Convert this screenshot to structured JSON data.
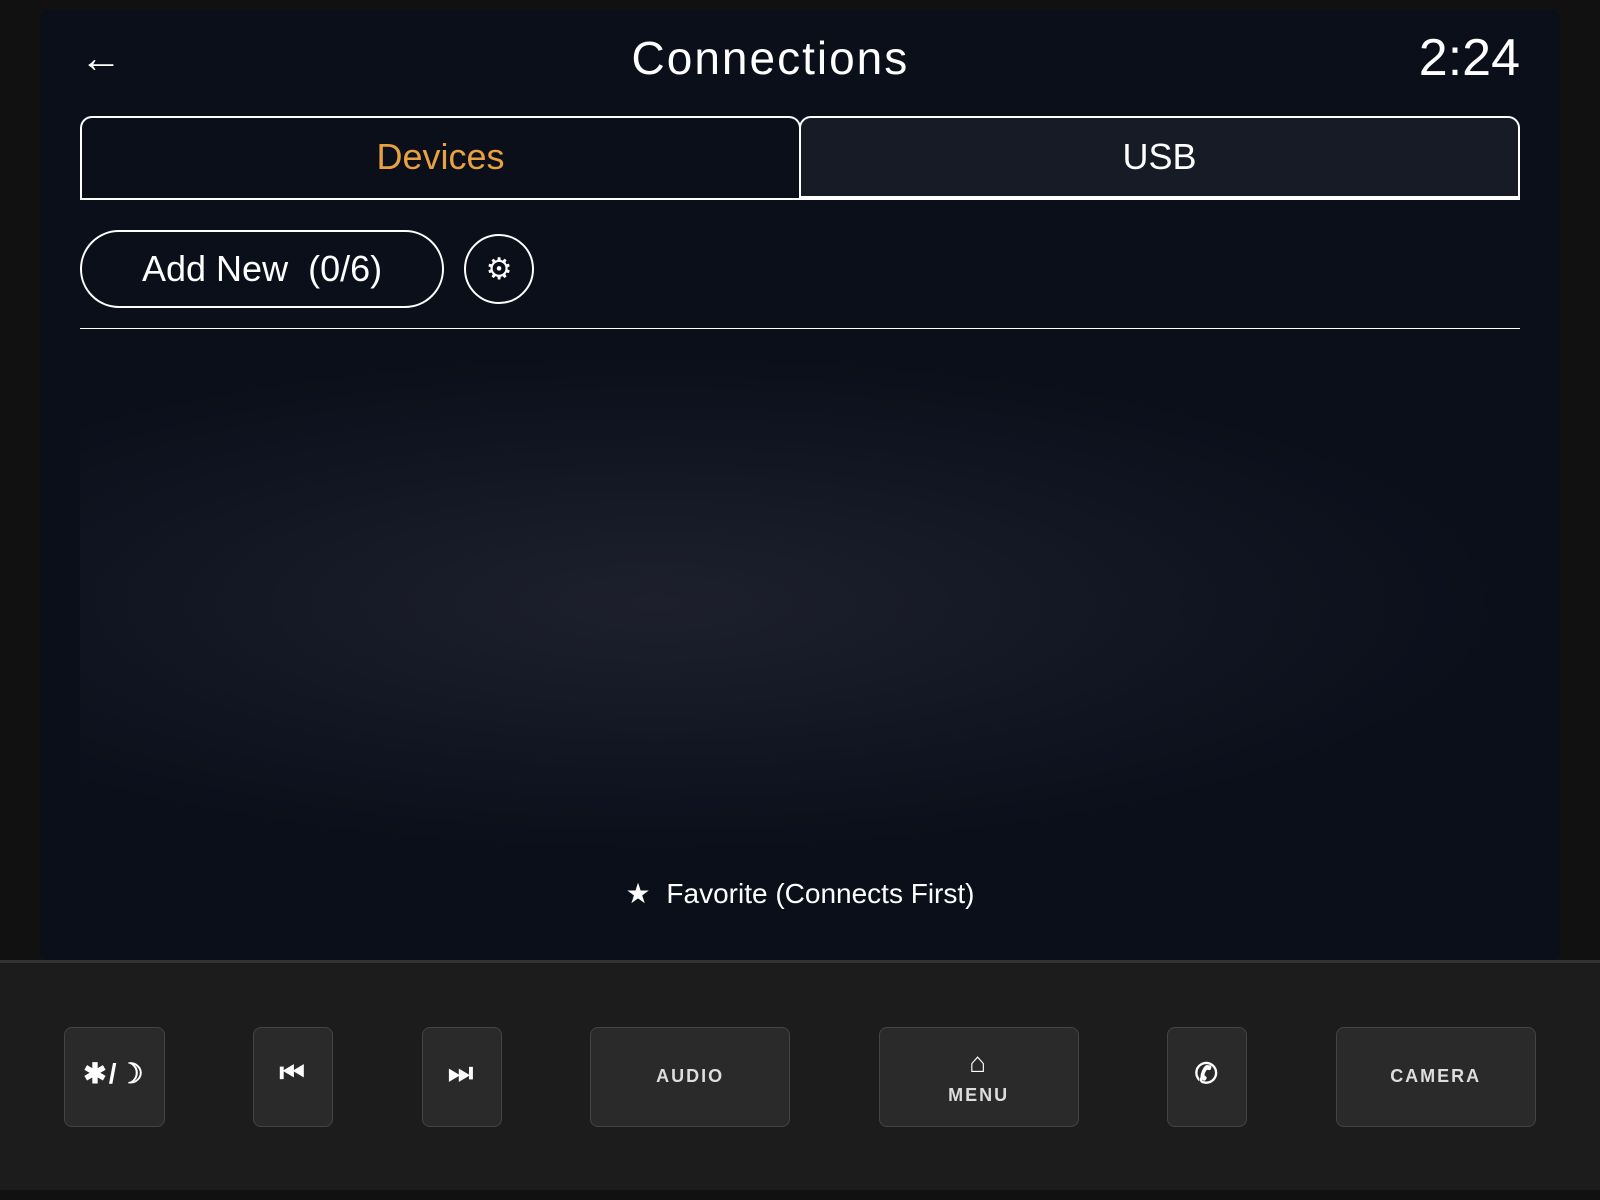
{
  "header": {
    "back_label": "←",
    "title": "Connections",
    "time": "2:24"
  },
  "tabs": [
    {
      "id": "devices",
      "label": "Devices",
      "active": true
    },
    {
      "id": "usb",
      "label": "USB",
      "active": false
    }
  ],
  "content": {
    "add_new_label": "Add New",
    "device_count": "(0/6)",
    "settings_icon": "⚙",
    "favorite_icon": "★",
    "favorite_text": "Favorite (Connects First)"
  },
  "hw_buttons": [
    {
      "id": "star-moon",
      "icon": "✱/☽",
      "label": ""
    },
    {
      "id": "prev",
      "icon": "⏮",
      "label": ""
    },
    {
      "id": "next",
      "icon": "⏭",
      "label": ""
    },
    {
      "id": "audio",
      "icon": "",
      "label": "AUDIO"
    },
    {
      "id": "menu",
      "icon": "⌂",
      "label": "MENU"
    },
    {
      "id": "phone",
      "icon": "✆",
      "label": ""
    },
    {
      "id": "camera",
      "icon": "",
      "label": "CAMERA"
    }
  ]
}
